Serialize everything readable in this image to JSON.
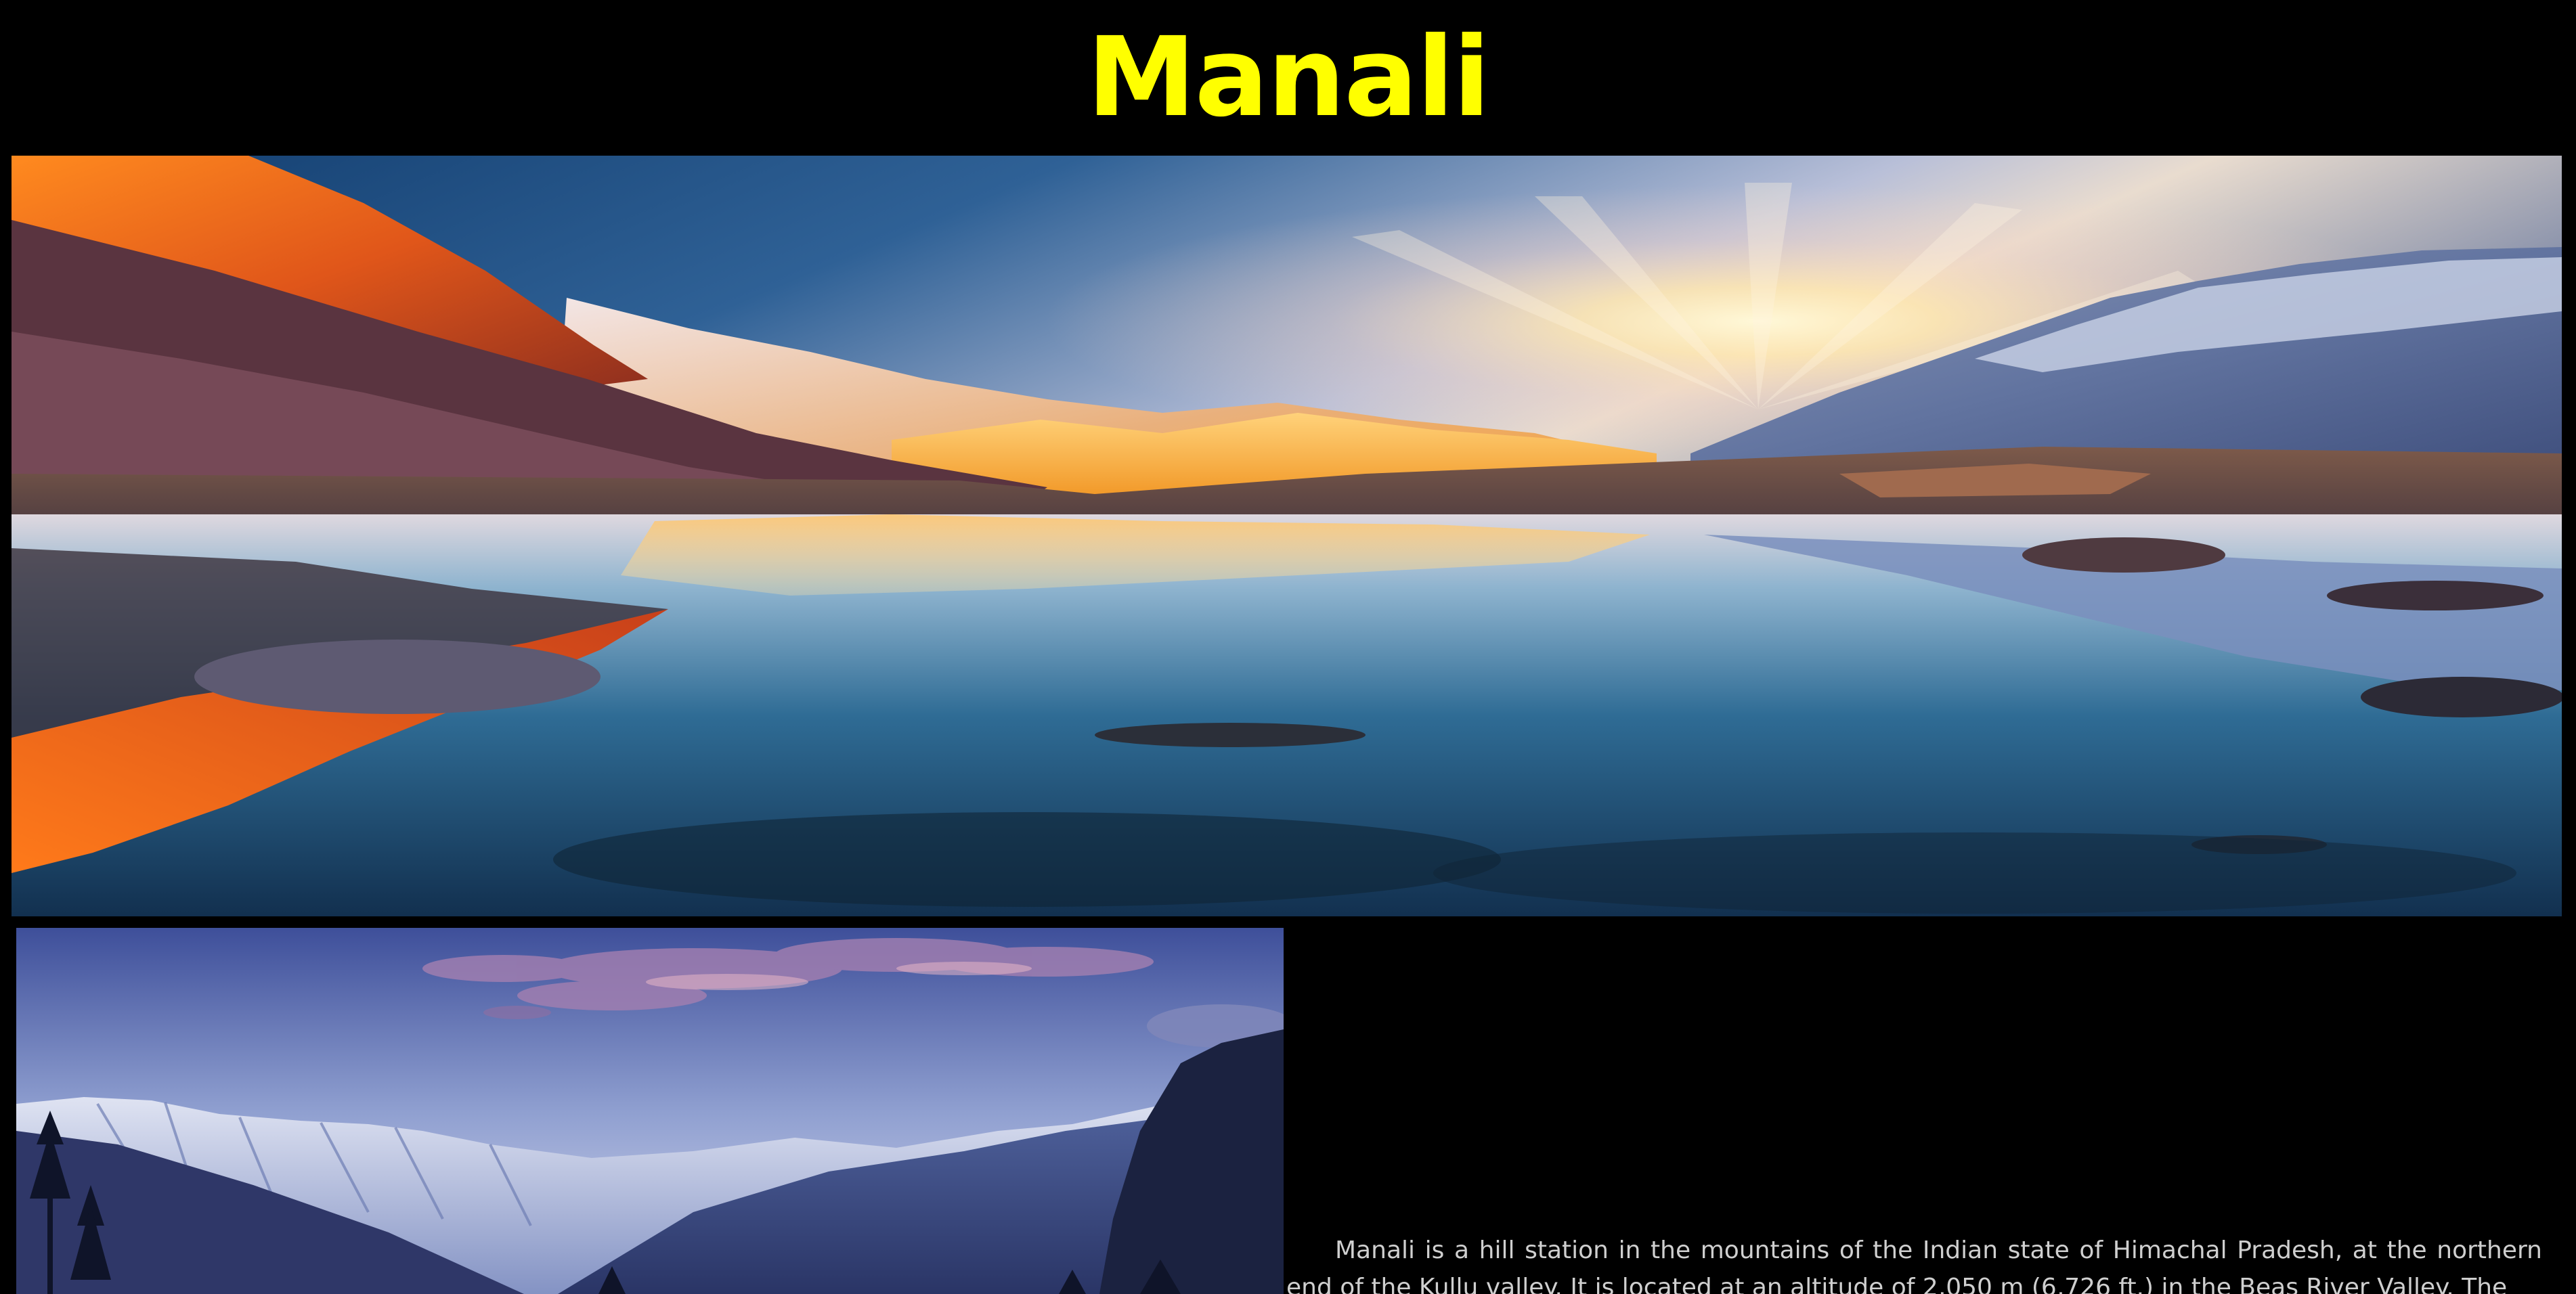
{
  "page": {
    "title": "Manali",
    "title_color": "#ffff00",
    "background": "#000000"
  },
  "hero_image": {
    "subject": "mountain lake at sunrise with reflections"
  },
  "secondary_image": {
    "subject": "snowy Himalayan valley at dusk with pine trees"
  },
  "description": {
    "text": "Manali is a hill station in the mountains of the Indian state of Himachal Pradesh, at the northern end of the Kullu valley. It is located at an altitude of 2,050 m (6,726 ft.) in the Beas River Valley. The",
    "color": "#cfcfcf"
  }
}
